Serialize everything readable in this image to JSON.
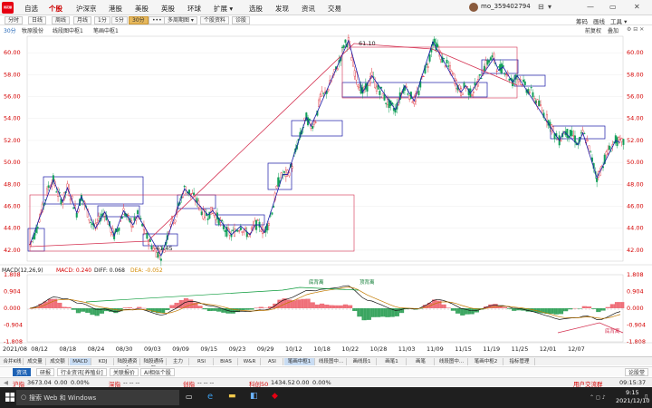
{
  "app": {
    "logo": "同花顺",
    "menus": [
      "自选",
      "个股",
      "沪深京",
      "港股",
      "美股",
      "英股",
      "环球",
      "扩展 ▾",
      "选股",
      "发现",
      "资讯",
      "交易"
    ],
    "active_menu": "个股",
    "user": "mo_359402794",
    "window_controls": [
      "⊟",
      "▾",
      "—",
      "▭",
      "✕"
    ]
  },
  "toolbar": {
    "periods": [
      "分时",
      "日线",
      "周线",
      "月线",
      "1分",
      "5分",
      "30分",
      "•••",
      "多周期图 ▾",
      "个股资料",
      "诊股"
    ],
    "selected_period": "30分",
    "right": [
      "筹码",
      "画线",
      "工具 ▾"
    ]
  },
  "subbar": {
    "period": "30分",
    "stock": "牧原股份",
    "indicator1": "线段图中枢1",
    "indicator2": "笔画中枢1",
    "right": [
      "前复权",
      "叠加"
    ]
  },
  "price_chart": {
    "y_ticks": [
      "60.00",
      "58.00",
      "56.00",
      "54.00",
      "52.00",
      "50.00",
      "48.00",
      "46.00",
      "44.00",
      "42.00"
    ],
    "high_label": "61.10",
    "low_label": "41.45"
  },
  "macd": {
    "title": "MACD(12,26,9)",
    "macd_label": "MACD: 0.240",
    "diff_label": "DIFF: 0.068",
    "dea_label": "DEA: -0.052",
    "y_ticks": [
      "1.808",
      "0.904",
      "0.000",
      "-0.904",
      "-1.808"
    ],
    "annotations": [
      "底背离",
      "顶背离",
      "底背离"
    ]
  },
  "x_axis": [
    "2021/08",
    "08/12",
    "08/18",
    "08/24",
    "08/30",
    "09/03",
    "09/09",
    "09/15",
    "09/23",
    "09/29",
    "10/12",
    "10/18",
    "10/22",
    "10/28",
    "11/03",
    "11/09",
    "11/15",
    "11/19",
    "11/25",
    "12/01",
    "12/07"
  ],
  "indicator_tabs": [
    "合并K线",
    "成交量",
    "成交额",
    "MACD",
    "KDJ",
    "陆股通资金",
    "陆股通持股",
    "主力",
    "RSI",
    "BIAS",
    "W&R",
    "ASI",
    "笔画中枢1",
    "线段图中...",
    "画线段1",
    "画笔1",
    "画笔",
    "线段图中...",
    "笔画中枢2",
    "指标管理"
  ],
  "selected_tab": "MACD",
  "info_tabs": [
    "资讯",
    "研报",
    "行业资讯[养殖业]",
    "关联报价",
    "AI相似个股"
  ],
  "info_right": "论股堂",
  "status": {
    "sh_label": "沪指",
    "sh_val": "3673.04",
    "sh_chg": "0.00",
    "sh_pct": "0.00%",
    "sz_label": "深指",
    "sz_val": "-- -- --",
    "cy_label": "创指",
    "cy_val": "-- -- --",
    "kc_label": "科创50",
    "kc_val": "1434.52",
    "kc_chg": "0.00",
    "kc_pct": "0.00%",
    "forum": "用户交流群",
    "clock": "09:15:37"
  },
  "taskbar": {
    "search": "搜索 Web 和 Windows",
    "time": "9:15",
    "date": "2021/12/10"
  },
  "chart_data": {
    "type": "candlestick",
    "price_series": [
      42.5,
      43.4,
      44.9,
      46.2,
      47.8,
      48.4,
      47.1,
      46.4,
      47.7,
      46.6,
      45.4,
      46.9,
      45.8,
      44.6,
      44.0,
      45.0,
      45.5,
      44.2,
      43.3,
      44.2,
      45.6,
      44.8,
      44.3,
      45.2,
      44.3,
      43.2,
      42.4,
      41.8,
      41.5,
      42.6,
      44.6,
      44.9,
      46.4,
      47.6,
      47.3,
      46.8,
      46.2,
      45.3,
      45.2,
      45.6,
      45.0,
      44.3,
      43.7,
      43.4,
      43.8,
      44.2,
      43.6,
      43.4,
      44.3,
      44.3,
      43.6,
      44.6,
      46.1,
      48.2,
      48.9,
      48.9,
      49.8,
      51.5,
      52.8,
      54.1,
      53.3,
      53.9,
      56.0,
      56.2,
      57.1,
      58.1,
      59.1,
      60.7,
      61.1,
      58.8,
      57.3,
      56.4,
      56.9,
      57.9,
      56.8,
      56.5,
      55.6,
      55.2,
      54.8,
      56.0,
      57.0,
      56.2,
      55.6,
      56.4,
      58.2,
      59.0,
      61.0,
      60.5,
      59.4,
      58.9,
      58.2,
      57.2,
      56.4,
      57.0,
      56.3,
      56.8,
      57.6,
      58.7,
      59.3,
      59.5,
      58.4,
      58.7,
      58.0,
      57.3,
      57.9,
      57.4,
      56.7,
      56.4,
      55.6,
      55.0,
      54.2,
      53.6,
      52.5,
      52.0,
      52.8,
      52.6,
      52.4,
      51.6,
      52.7,
      51.8,
      50.2,
      48.6,
      49.5,
      50.7,
      51.4,
      52.0,
      51.8
    ],
    "price_ylim": [
      41.0,
      61.5
    ],
    "macd_ylim": [
      -1.808,
      1.808
    ],
    "xlabel": "",
    "ylabel": ""
  }
}
